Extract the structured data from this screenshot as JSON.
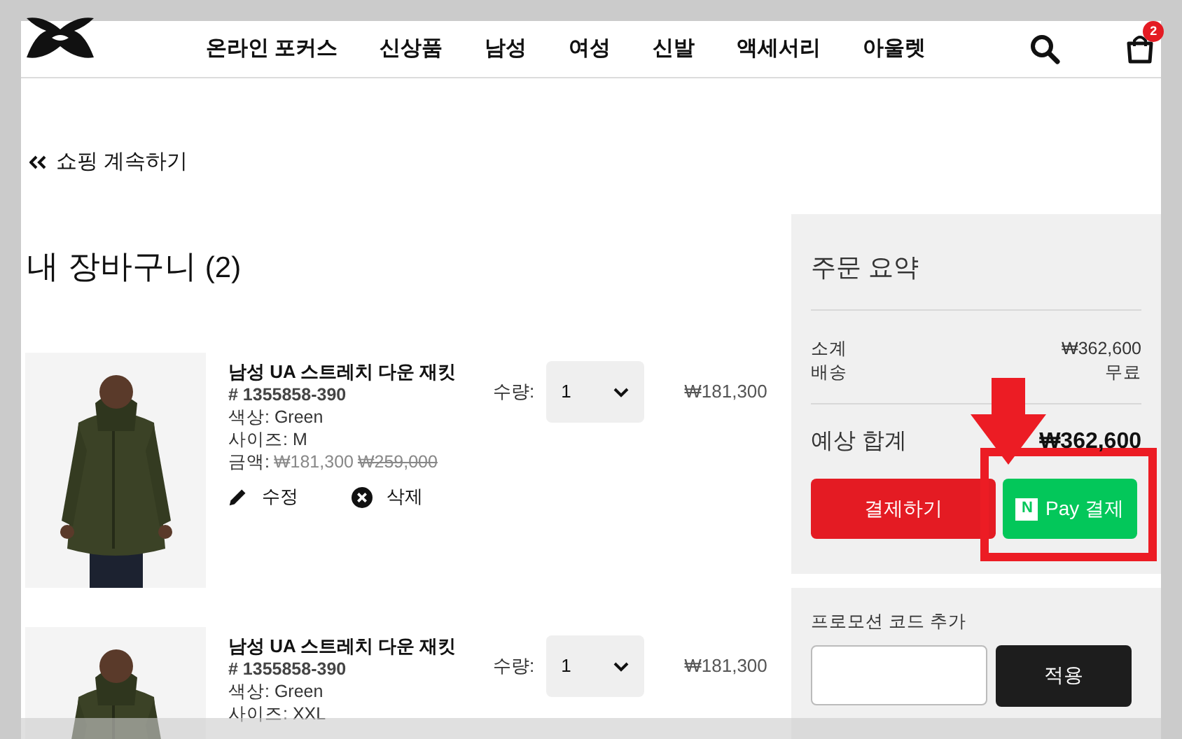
{
  "header": {
    "nav": [
      "온라인 포커스",
      "신상품",
      "남성",
      "여성",
      "신발",
      "액세서리",
      "아울렛"
    ],
    "cart_count": "2"
  },
  "back_link": "쇼핑 계속하기",
  "cart": {
    "title": "내 장바구니",
    "count": "(2)"
  },
  "items": [
    {
      "name": "남성 UA 스트레치 다운 재킷",
      "sku": "# 1355858-390",
      "colour_line": "색상: Green",
      "size": "사이즈: M",
      "price_label": "금액:",
      "sale": "₩181,300",
      "original": "₩259,000",
      "qty_label": "수량:",
      "qty": "1",
      "total": "₩181,300",
      "actions": [
        "수정",
        "삭제"
      ]
    },
    {
      "name": "남성 UA 스트레치 다운 재킷",
      "sku": "# 1355858-390",
      "colour_line": "색상: Green",
      "size": "사이즈: XXL",
      "qty_label": "수량:",
      "qty": "1",
      "total": "₩181,300"
    }
  ],
  "summary": {
    "title": "주문 요약",
    "lines": [
      {
        "label": "소계",
        "value": "₩362,600"
      },
      {
        "label": "배송",
        "value": "무료"
      }
    ],
    "total_label": "예상 합계",
    "total": "₩362,600",
    "checkout": "결제하기",
    "npay_logo": "N",
    "npay": "Pay 결제"
  },
  "promo": {
    "label": "프로모션 코드 추가",
    "apply": "적용"
  }
}
